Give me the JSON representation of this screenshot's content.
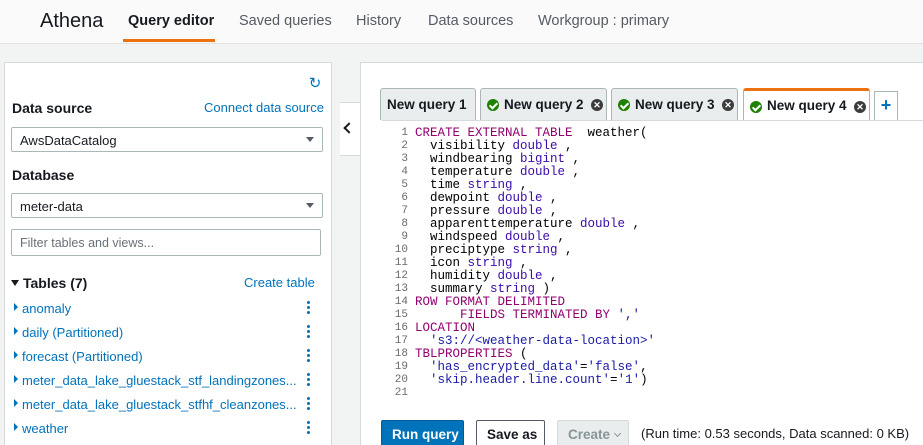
{
  "nav": {
    "brand": "Athena",
    "items": [
      "Query editor",
      "Saved queries",
      "History",
      "Data sources",
      "Workgroup : primary"
    ],
    "active_index": 0,
    "accent_color": "#ec7211"
  },
  "left": {
    "data_source_title": "Data source",
    "connect_link": "Connect data source",
    "data_source_value": "AwsDataCatalog",
    "database_title": "Database",
    "database_value": "meter-data",
    "filter_placeholder": "Filter tables and views...",
    "tables_title": "Tables (7)",
    "create_table_link": "Create table",
    "tables": [
      "anomaly",
      "daily (Partitioned)",
      "forecast (Partitioned)",
      "meter_data_lake_gluestack_stf_landingzones...",
      "meter_data_lake_gluestack_stfhf_cleanzones...",
      "weather"
    ]
  },
  "tabs": [
    {
      "label": "New query 1",
      "status": "none",
      "active": false
    },
    {
      "label": "New query 2",
      "status": "success",
      "active": false
    },
    {
      "label": "New query 3",
      "status": "success",
      "active": false
    },
    {
      "label": "New query 4",
      "status": "success",
      "active": true
    }
  ],
  "editor": {
    "line_numbers": [
      "1",
      "2",
      "3",
      "4",
      "5",
      "6",
      "7",
      "8",
      "9",
      "10",
      "11",
      "12",
      "13",
      "14",
      "15",
      "16",
      "17",
      "18",
      "19",
      "20",
      "21"
    ],
    "lines": [
      [
        [
          "kw",
          "CREATE EXTERNAL TABLE"
        ],
        [
          "",
          "  weather("
        ]
      ],
      [
        [
          "",
          "  visibility "
        ],
        [
          "ty",
          "double"
        ],
        [
          "",
          " ,"
        ]
      ],
      [
        [
          "",
          "  windbearing "
        ],
        [
          "ty",
          "bigint"
        ],
        [
          "",
          " ,"
        ]
      ],
      [
        [
          "",
          "  temperature "
        ],
        [
          "ty",
          "double"
        ],
        [
          "",
          " ,"
        ]
      ],
      [
        [
          "",
          "  time "
        ],
        [
          "ty",
          "string"
        ],
        [
          "",
          " ,"
        ]
      ],
      [
        [
          "",
          "  dewpoint "
        ],
        [
          "ty",
          "double"
        ],
        [
          "",
          " ,"
        ]
      ],
      [
        [
          "",
          "  pressure "
        ],
        [
          "ty",
          "double"
        ],
        [
          "",
          " ,"
        ]
      ],
      [
        [
          "",
          "  apparenttemperature "
        ],
        [
          "ty",
          "double"
        ],
        [
          "",
          " ,"
        ]
      ],
      [
        [
          "",
          "  windspeed "
        ],
        [
          "ty",
          "double"
        ],
        [
          "",
          " ,"
        ]
      ],
      [
        [
          "",
          "  preciptype "
        ],
        [
          "ty",
          "string"
        ],
        [
          "",
          " ,"
        ]
      ],
      [
        [
          "",
          "  icon "
        ],
        [
          "ty",
          "string"
        ],
        [
          "",
          " ,"
        ]
      ],
      [
        [
          "",
          "  humidity "
        ],
        [
          "ty",
          "double"
        ],
        [
          "",
          " ,"
        ]
      ],
      [
        [
          "",
          "  summary "
        ],
        [
          "ty",
          "string"
        ],
        [
          "",
          " )"
        ]
      ],
      [
        [
          "kw",
          "ROW FORMAT DELIMITED"
        ]
      ],
      [
        [
          "kw",
          "      FIELDS TERMINATED BY "
        ],
        [
          "st",
          "','"
        ]
      ],
      [
        [
          "kw",
          "LOCATION"
        ]
      ],
      [
        [
          "st",
          "  's3://<weather-data-location>'"
        ]
      ],
      [
        [
          "kw",
          "TBLPROPERTIES"
        ],
        [
          "",
          " ("
        ]
      ],
      [
        [
          "st",
          "  'has_encrypted_data'"
        ],
        [
          "",
          "="
        ],
        [
          "st",
          "'false'"
        ],
        [
          "",
          ","
        ]
      ],
      [
        [
          "st",
          "  'skip.header.line.count'"
        ],
        [
          "",
          "="
        ],
        [
          "st",
          "'1'"
        ],
        [
          "",
          ")"
        ]
      ],
      [
        [
          "",
          ""
        ]
      ]
    ]
  },
  "actions": {
    "run_query": "Run query",
    "save_as": "Save as",
    "create": "Create",
    "run_info": "(Run time: 0.53 seconds, Data scanned: 0 KB)"
  }
}
